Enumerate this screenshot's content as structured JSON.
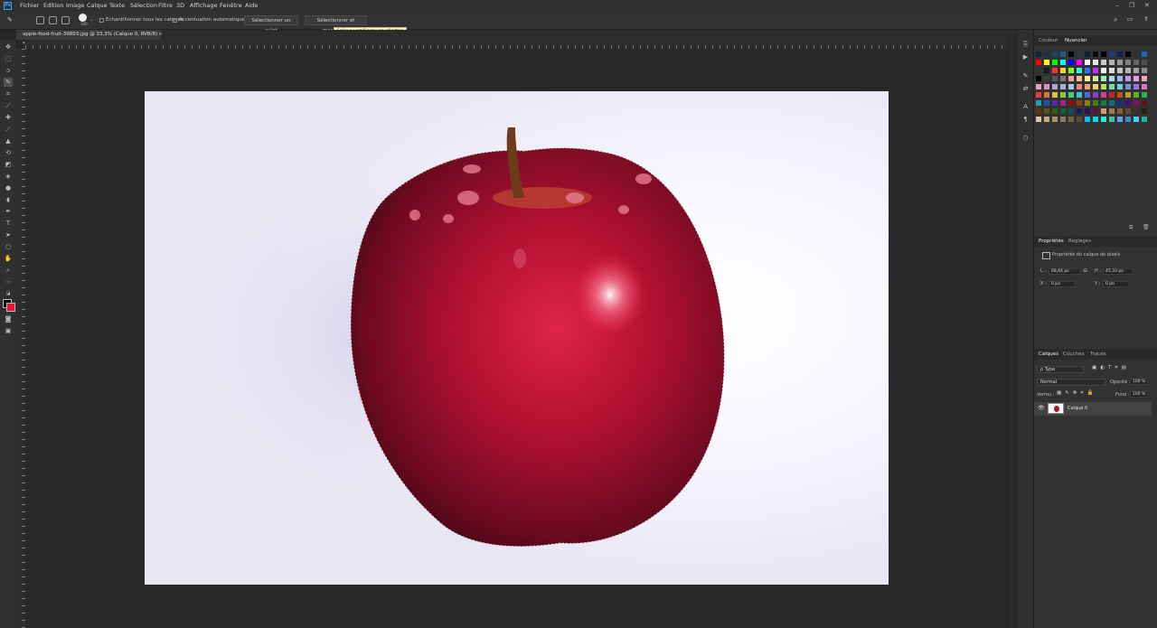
{
  "menu": {
    "logo": "Ps",
    "items": [
      "Fichier",
      "Edition",
      "Image",
      "Calque",
      "Texte",
      "Sélection",
      "Filtre",
      "3D",
      "Affichage",
      "Fenêtre",
      "Aide"
    ]
  },
  "options": {
    "brush_size": "100",
    "sample_all_label": "Echantillonner tous les calques",
    "auto_enhance_label": "Accentuation automatique",
    "select_subject": "Sélectionner un sujet",
    "select_mask": "Sélectionner et masquer...",
    "tooltip": "Créer ou améliorer une sélection"
  },
  "document": {
    "tab_title": "apple-food-fruit-39803.jpg @ 33,3% (Calque 0, RVB/8) *",
    "close_glyph": "×"
  },
  "panels": {
    "color_tabs": [
      "Couleur",
      "Nuancier"
    ],
    "props_tabs": [
      "Propriétés",
      "Réglages"
    ],
    "props_title": "Propriétés du calque de pixels",
    "L_label": "L :",
    "L_value": "68,44 po",
    "H_label": "H :",
    "H_value": "45,33 po",
    "X_label": "X :",
    "X_value": "0 po",
    "Y_label": "Y :",
    "Y_value": "0 po",
    "link_glyph": "⊖",
    "layers_tabs": [
      "Calques",
      "Couches",
      "Tracés"
    ],
    "filter_label": "ρ Type",
    "blend_mode": "Normal",
    "opacity_label": "Opacité :",
    "opacity_value": "100 %",
    "lock_label": "Verrou :",
    "fill_label": "Fond :",
    "fill_value": "100 %",
    "layer_name": "Calque 0"
  },
  "swatch_colors": [
    [
      "#1b2433",
      "#1d2e47",
      "#20446b",
      "#1c5a86",
      "#000000",
      "#2f3740",
      "#14202d",
      "#0d0d0d",
      "#000000",
      "#1d3b86",
      "#0f1f58",
      "#000000",
      "#333333",
      "#1e65c8"
    ],
    [
      "#ff0000",
      "#ffff00",
      "#00ff00",
      "#00ffff",
      "#0000ff",
      "#ff00ff",
      "#ffffff",
      "#e6e6e6",
      "#cccccc",
      "#b3b3b3",
      "#999999",
      "#808080",
      "#666666",
      "#4d4d4d"
    ],
    [
      "#333333",
      "#1a1a1a",
      "#ff3030",
      "#ffd020",
      "#80ff20",
      "#20ffd0",
      "#3070ff",
      "#c030ff",
      "#f0f0f0",
      "#dcdcdc",
      "#c8c8c8",
      "#b4b4b4",
      "#a0a0a0",
      "#8c8c8c"
    ],
    [
      "#000000",
      "#3a3a3a",
      "#555555",
      "#777777",
      "#f2a0a0",
      "#f8c090",
      "#fff098",
      "#c8f098",
      "#98f0c0",
      "#98e0f8",
      "#98b8f8",
      "#c098f8",
      "#f098e0",
      "#f8a0c0"
    ],
    [
      "#e8a0c8",
      "#d890c0",
      "#b8a0d8",
      "#a8b0e0",
      "#a0c8f0",
      "#f08080",
      "#f0a070",
      "#f0d070",
      "#b0e070",
      "#70e0a0",
      "#70d0e0",
      "#7090e0",
      "#a070e0",
      "#e070c0"
    ],
    [
      "#e04040",
      "#e07040",
      "#e0c040",
      "#80d040",
      "#40d080",
      "#40c0d0",
      "#4070d0",
      "#8040d0",
      "#d040a0",
      "#c02020",
      "#c05020",
      "#c0a020",
      "#60b020",
      "#20b060"
    ],
    [
      "#20a0b0",
      "#2050b0",
      "#6020b0",
      "#b02080",
      "#901010",
      "#904010",
      "#908010",
      "#408010",
      "#108040",
      "#107080",
      "#103080",
      "#401080",
      "#801060",
      "#601010"
    ],
    [
      "#603010",
      "#605010",
      "#306010",
      "#106030",
      "#105060",
      "#102060",
      "#301060",
      "#601040",
      "#c8a070",
      "#a07850",
      "#806040",
      "#604830",
      "#403020",
      "#2a2010"
    ],
    [
      "#d8c8a8",
      "#c0a888",
      "#a89070",
      "#907858",
      "#786048",
      "#604830",
      "#00c0f0",
      "#00e0f0",
      "#20f0d0",
      "#40c0a0",
      "#60a0f0",
      "#3090d0",
      "#40d0f0",
      "#20b0a0"
    ]
  ]
}
